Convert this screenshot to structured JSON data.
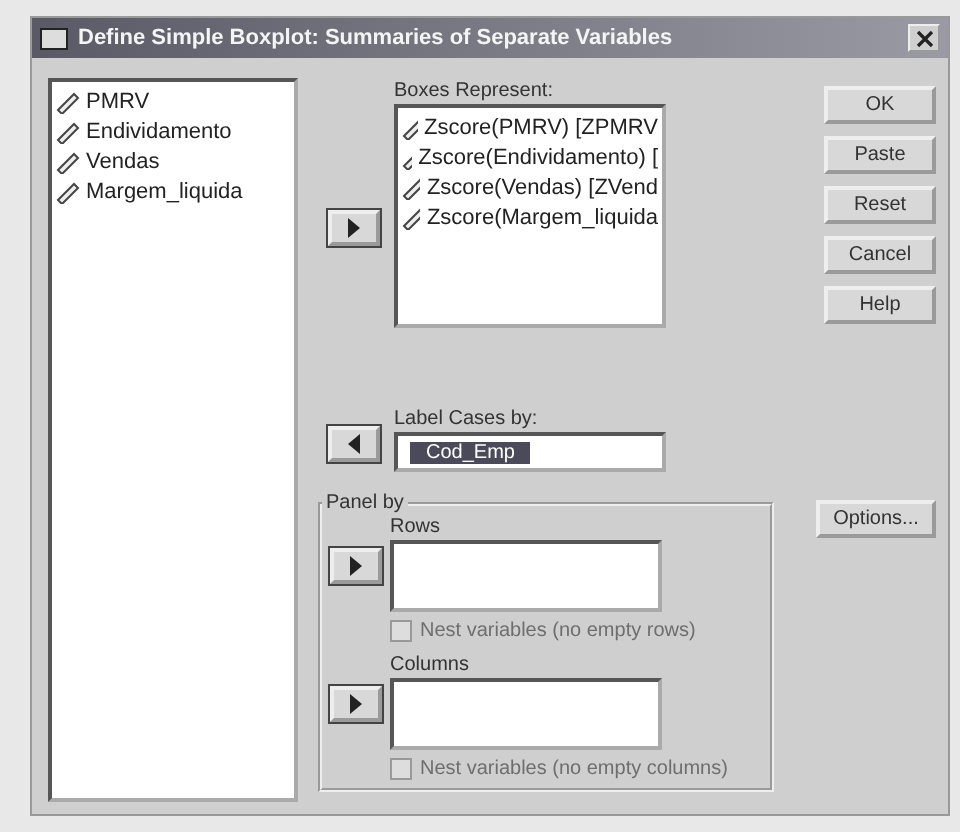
{
  "window": {
    "title": "Define Simple Boxplot: Summaries of Separate Variables"
  },
  "variables": [
    {
      "name": "PMRV"
    },
    {
      "name": "Endividamento"
    },
    {
      "name": "Vendas"
    },
    {
      "name": "Margem_liquida"
    }
  ],
  "boxes_represent": {
    "label": "Boxes Represent:",
    "items": [
      {
        "name": "Zscore(PMRV) [ZPMRV"
      },
      {
        "name": "Zscore(Endividamento) ["
      },
      {
        "name": "Zscore(Vendas) [ZVend"
      },
      {
        "name": "Zscore(Margem_liquida"
      }
    ]
  },
  "buttons": [
    {
      "label": "OK"
    },
    {
      "label": "Paste"
    },
    {
      "label": "Reset"
    },
    {
      "label": "Cancel"
    },
    {
      "label": "Help"
    }
  ],
  "label_cases": {
    "label": "Label Cases by:",
    "value": "Cod_Emp",
    "selected": true
  },
  "panel_by": {
    "title": "Panel by",
    "sections": [
      {
        "label": "Rows",
        "nest": {
          "label": "Nest variables (no empty rows)",
          "checked": false,
          "disabled": true
        }
      },
      {
        "label": "Columns",
        "nest": {
          "label": "Nest variables (no empty columns)",
          "checked": false,
          "disabled": true
        }
      }
    ]
  },
  "options_button": {
    "label": "Options..."
  }
}
